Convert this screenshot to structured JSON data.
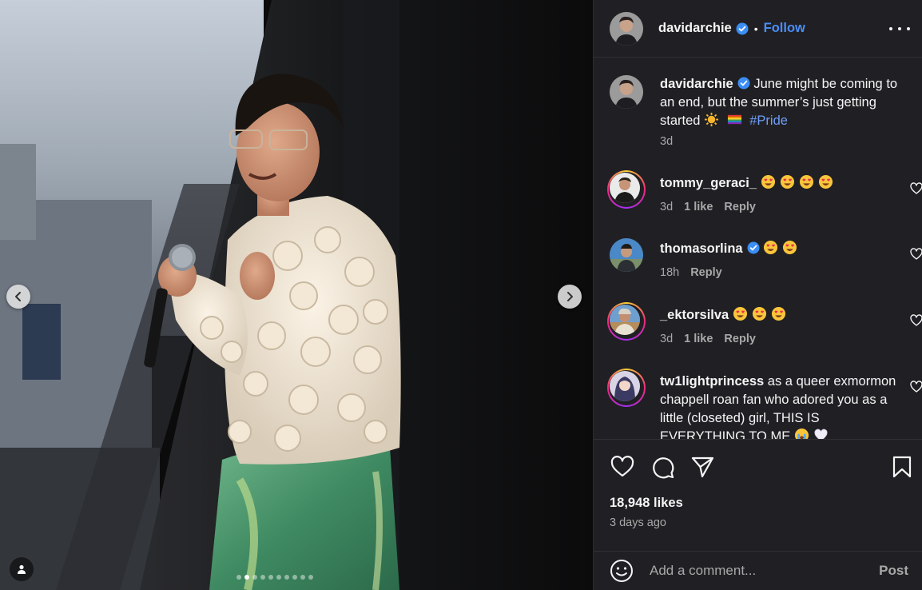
{
  "post": {
    "author": "davidarchie",
    "follow_label": "Follow",
    "separator": "•",
    "caption": {
      "text": "June might be coming to an end, but the summer’s just getting started",
      "hashtag": "#Pride",
      "time": "3d"
    }
  },
  "comments": [
    {
      "username": "tommy_geraci_",
      "text": "",
      "emojis": [
        "heart-eyes",
        "heart-eyes",
        "heart-eyes",
        "heart-eyes"
      ],
      "time": "3d",
      "likes": "1 like",
      "reply": "Reply",
      "verified": false
    },
    {
      "username": "thomasorlina",
      "text": "",
      "emojis": [
        "heart-eyes",
        "heart-eyes"
      ],
      "time": "18h",
      "likes": "",
      "reply": "Reply",
      "verified": true
    },
    {
      "username": "_ektorsilva",
      "text": "",
      "emojis": [
        "heart-eyes",
        "heart-eyes",
        "heart-eyes"
      ],
      "time": "3d",
      "likes": "1 like",
      "reply": "Reply",
      "verified": false
    },
    {
      "username": "tw1lightprincess",
      "text": "as a queer exmormon chappell roan fan who adored you as a little (closeted) girl, THIS IS EVERYTHING TO ME",
      "emojis": [
        "crying",
        "white-heart"
      ],
      "time": "",
      "likes": "",
      "reply": "",
      "verified": false
    }
  ],
  "engagement": {
    "likes": "18,948 likes",
    "posted": "3 days ago"
  },
  "composer": {
    "placeholder": "Add a comment...",
    "post_label": "Post"
  },
  "carousel": {
    "total": 10,
    "active_index": 1
  },
  "icons": {
    "verified": "verified-badge-icon",
    "more": "more-options-icon",
    "like": "heart-icon",
    "comment": "comment-icon",
    "share": "share-icon",
    "save": "bookmark-icon",
    "emoji": "smiley-icon",
    "tags": "user-tag-icon",
    "prev": "chevron-left-icon",
    "next": "chevron-right-icon"
  },
  "colors": {
    "panel_bg": "#202024",
    "link_blue": "#4a8ef7",
    "hashtag_blue": "#6f9ef7",
    "muted": "#a8a8a8",
    "verified_blue": "#3a8ef6"
  }
}
